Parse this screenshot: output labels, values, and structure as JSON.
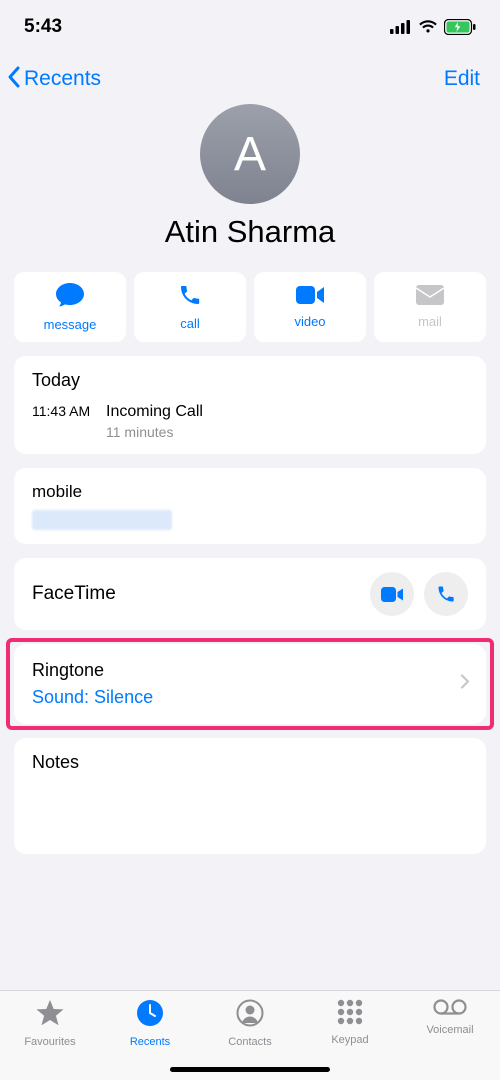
{
  "status": {
    "time": "5:43"
  },
  "nav": {
    "back": "Recents",
    "edit": "Edit"
  },
  "contact": {
    "initial": "A",
    "name": "Atin Sharma"
  },
  "actions": {
    "message": "message",
    "call": "call",
    "video": "video",
    "mail": "mail"
  },
  "callLog": {
    "heading": "Today",
    "time": "11:43 AM",
    "type": "Incoming Call",
    "duration": "11 minutes"
  },
  "mobile": {
    "label": "mobile"
  },
  "facetime": {
    "label": "FaceTime"
  },
  "ringtone": {
    "label": "Ringtone",
    "value": "Sound: Silence"
  },
  "notes": {
    "label": "Notes"
  },
  "tabs": {
    "favourites": "Favourites",
    "recents": "Recents",
    "contacts": "Contacts",
    "keypad": "Keypad",
    "voicemail": "Voicemail"
  }
}
